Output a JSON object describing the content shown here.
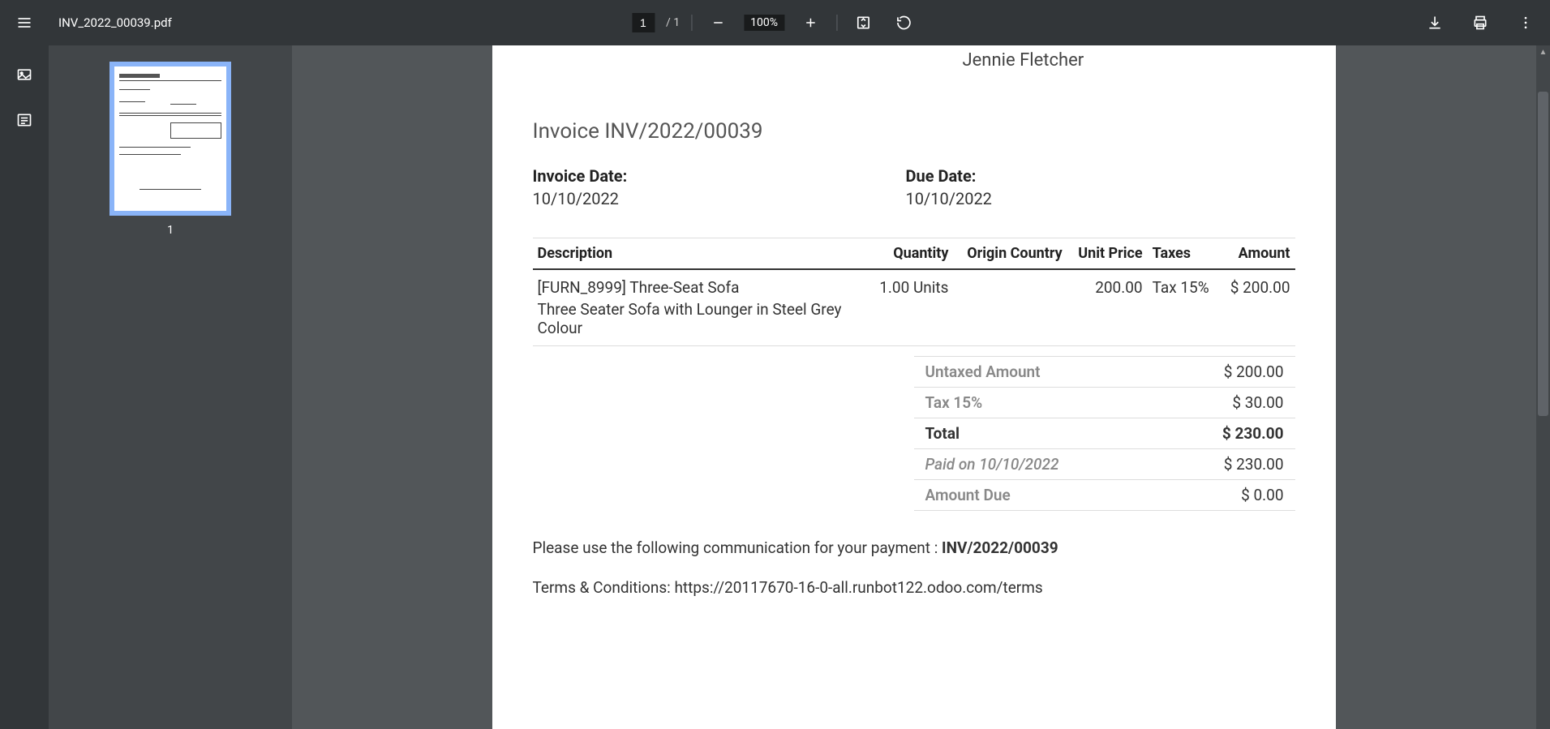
{
  "header": {
    "filename": "INV_2022_00039.pdf",
    "current_page": "1",
    "total_pages": "1",
    "zoom": "100%"
  },
  "thumbnail": {
    "page_label": "1"
  },
  "invoice": {
    "customer_name": "Jennie Fletcher",
    "title": "Invoice INV/2022/00039",
    "invoice_date_label": "Invoice Date:",
    "invoice_date": "10/10/2022",
    "due_date_label": "Due Date:",
    "due_date": "10/10/2022",
    "columns": {
      "description": "Description",
      "quantity": "Quantity",
      "origin_country": "Origin Country",
      "unit_price": "Unit Price",
      "taxes": "Taxes",
      "amount": "Amount"
    },
    "line": {
      "name": "[FURN_8999] Three-Seat Sofa",
      "desc": "Three Seater Sofa with Lounger in Steel Grey Colour",
      "quantity": "1.00 Units",
      "origin_country": "",
      "unit_price": "200.00",
      "taxes": "Tax 15%",
      "amount": "$ 200.00"
    },
    "totals": {
      "untaxed_label": "Untaxed Amount",
      "untaxed_value": "$ 200.00",
      "tax_label": "Tax 15%",
      "tax_value": "$ 30.00",
      "total_label": "Total",
      "total_value": "$ 230.00",
      "paid_label": "Paid on 10/10/2022",
      "paid_value": "$ 230.00",
      "due_label": "Amount Due",
      "due_value": "$ 0.00"
    },
    "communication_prefix": "Please use the following communication for your payment : ",
    "communication_ref": "INV/2022/00039",
    "terms": "Terms & Conditions: https://20117670-16-0-all.runbot122.odoo.com/terms"
  }
}
